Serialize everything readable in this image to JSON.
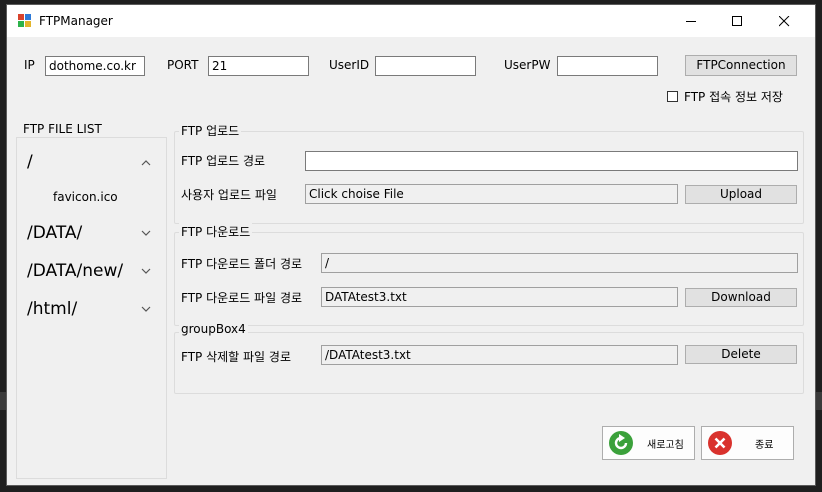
{
  "window": {
    "title": "FTPManager",
    "icon": "ftpmanager-app-icon",
    "controls": [
      "minimize-icon",
      "maximize-icon",
      "close-icon"
    ]
  },
  "connection": {
    "ip_label": "IP",
    "ip_value": "dothome.co.kr",
    "port_label": "PORT",
    "port_value": "21",
    "userid_label": "UserID",
    "userid_value": "",
    "userpw_label": "UserPW",
    "userpw_value": "",
    "connect_button": "FTPConnection",
    "save_checkbox_label": "FTP 접속 정보 저장",
    "save_checked": false
  },
  "file_list": {
    "title": "FTP FILE LIST",
    "items": [
      {
        "label": "/",
        "expanded": true,
        "children": [
          "favicon.ico"
        ]
      },
      {
        "label": "/DATA/",
        "expanded": false
      },
      {
        "label": "/DATA/new/",
        "expanded": false
      },
      {
        "label": "/html/",
        "expanded": false
      }
    ]
  },
  "upload": {
    "title": "FTP 업로드",
    "path_label": "FTP 업로드 경로",
    "path_value": "",
    "file_label": "사용자 업로드 파일",
    "file_value": "Click choise File",
    "button": "Upload"
  },
  "download": {
    "title": "FTP 다운로드",
    "folder_label": "FTP 다운로드 폴더 경로",
    "folder_value": "/",
    "file_label": "FTP 다운로드 파일 경로",
    "file_value": "DATAtest3.txt",
    "button": "Download"
  },
  "delete": {
    "title": "groupBox4",
    "file_label": "FTP 삭제할 파일 경로",
    "file_value": "/DATAtest3.txt",
    "button": "Delete"
  },
  "footer": {
    "refresh_button": "새로고침",
    "exit_button": "종료"
  },
  "colors": {
    "refresh_icon": "#3ba13b",
    "exit_icon": "#d9322d",
    "window_bg": "#f0f0f0"
  }
}
